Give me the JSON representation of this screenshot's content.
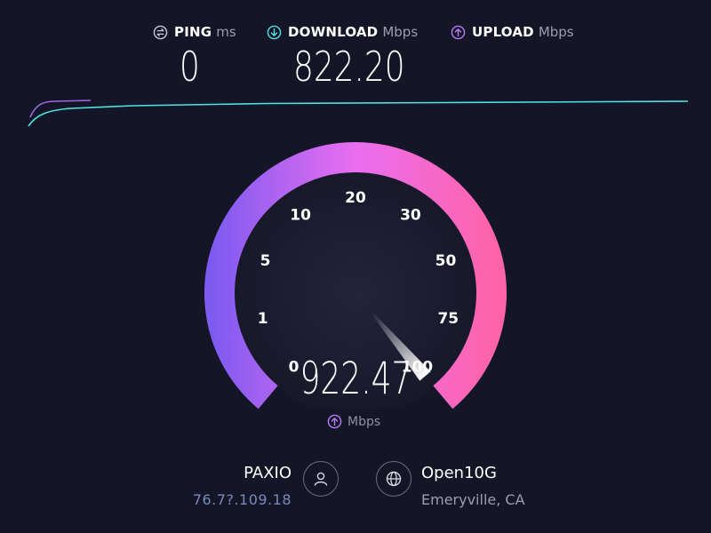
{
  "metrics": {
    "ping": {
      "label": "PING",
      "unit": "ms",
      "value": "0",
      "icon": "ping-icon",
      "color": "#c7c9d6"
    },
    "download": {
      "label": "DOWNLOAD",
      "unit": "Mbps",
      "value": "822.20",
      "icon": "download-arrow-icon",
      "color": "#4fe3df"
    },
    "upload": {
      "label": "UPLOAD",
      "unit": "Mbps",
      "value": "",
      "icon": "upload-arrow-icon",
      "color": "#b77cf6"
    }
  },
  "gauge": {
    "ticks": [
      "0",
      "1",
      "5",
      "10",
      "20",
      "30",
      "50",
      "75",
      "100"
    ],
    "current_value": "922.47",
    "unit": "Mbps",
    "unit_icon": "upload-arrow-icon",
    "gradient_start": "#7e5bf0",
    "gradient_mid": "#ea6ef0",
    "gradient_end": "#ff63a8",
    "needle_fraction": 1.0
  },
  "provider": {
    "name": "PAXIO",
    "ip": "76.7?.109.18",
    "icon": "user-icon"
  },
  "server": {
    "name": "Open10G",
    "location": "Emeryville, CA",
    "icon": "globe-icon"
  }
}
